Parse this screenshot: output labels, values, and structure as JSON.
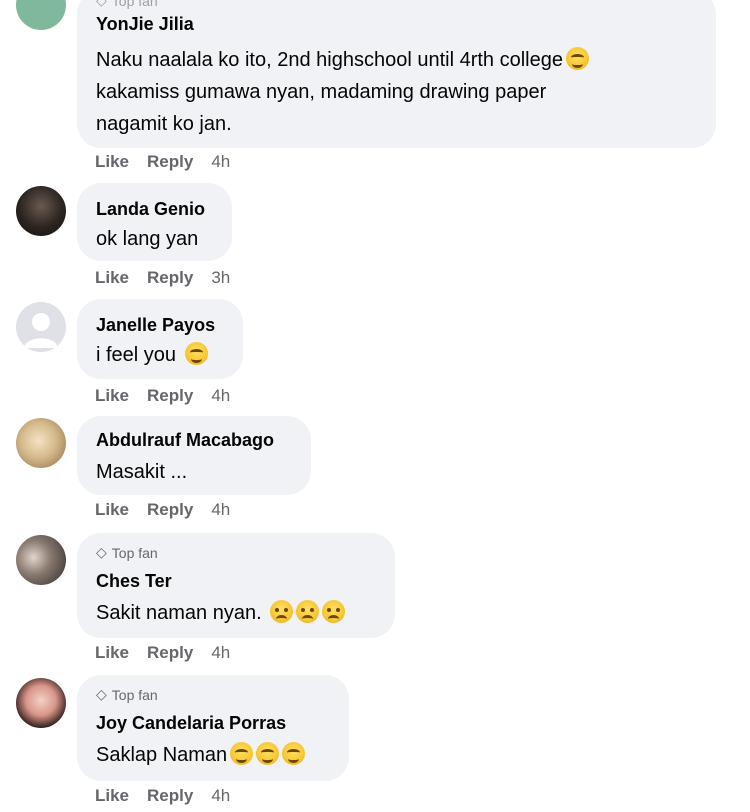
{
  "comments": [
    {
      "author": "YonJie Jilia",
      "badge": "Top fan",
      "lines": [
        "Naku naalala ko ito, 2nd highschool until 4rth college",
        "kakamiss gumawa nyan, madaming drawing paper",
        "nagamit ko jan."
      ],
      "like": "Like",
      "reply": "Reply",
      "time": "4h"
    },
    {
      "author": "Landa Genio",
      "lines": [
        "ok lang yan"
      ],
      "like": "Like",
      "reply": "Reply",
      "time": "3h"
    },
    {
      "author": "Janelle Payos",
      "lines": [
        "i feel you"
      ],
      "like": "Like",
      "reply": "Reply",
      "time": "4h"
    },
    {
      "author": "Abdulrauf Macabago",
      "lines": [
        "Masakit ..."
      ],
      "like": "Like",
      "reply": "Reply",
      "time": "4h"
    },
    {
      "author": "Ches Ter",
      "badge": "Top fan",
      "lines": [
        "Sakit naman nyan."
      ],
      "like": "Like",
      "reply": "Reply",
      "time": "4h"
    },
    {
      "author": "Joy Candelaria Porras",
      "badge": "Top fan",
      "lines": [
        "Saklap Naman"
      ],
      "like": "Like",
      "reply": "Reply",
      "time": "4h"
    }
  ],
  "icons": {
    "badge_icon": "diamond-icon",
    "emoji": "smiling-face-emoji",
    "sad_emoji": "sad-face-emoji"
  }
}
